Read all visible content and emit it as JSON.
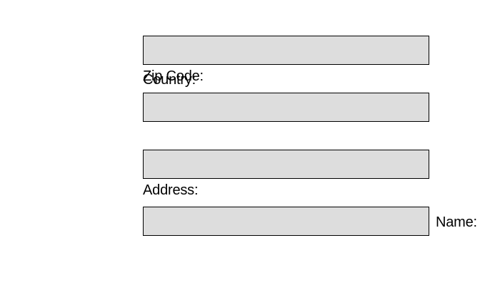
{
  "form": {
    "fields": [
      {
        "label": "Zip Code:",
        "value": ""
      },
      {
        "label": "Country:",
        "value": ""
      },
      {
        "label": "Address:",
        "value": ""
      },
      {
        "label": "Name:",
        "value": ""
      }
    ]
  },
  "colors": {
    "field_background": "#dddddd",
    "field_border": "#000000",
    "page_background": "#ffffff",
    "text": "#000000"
  }
}
